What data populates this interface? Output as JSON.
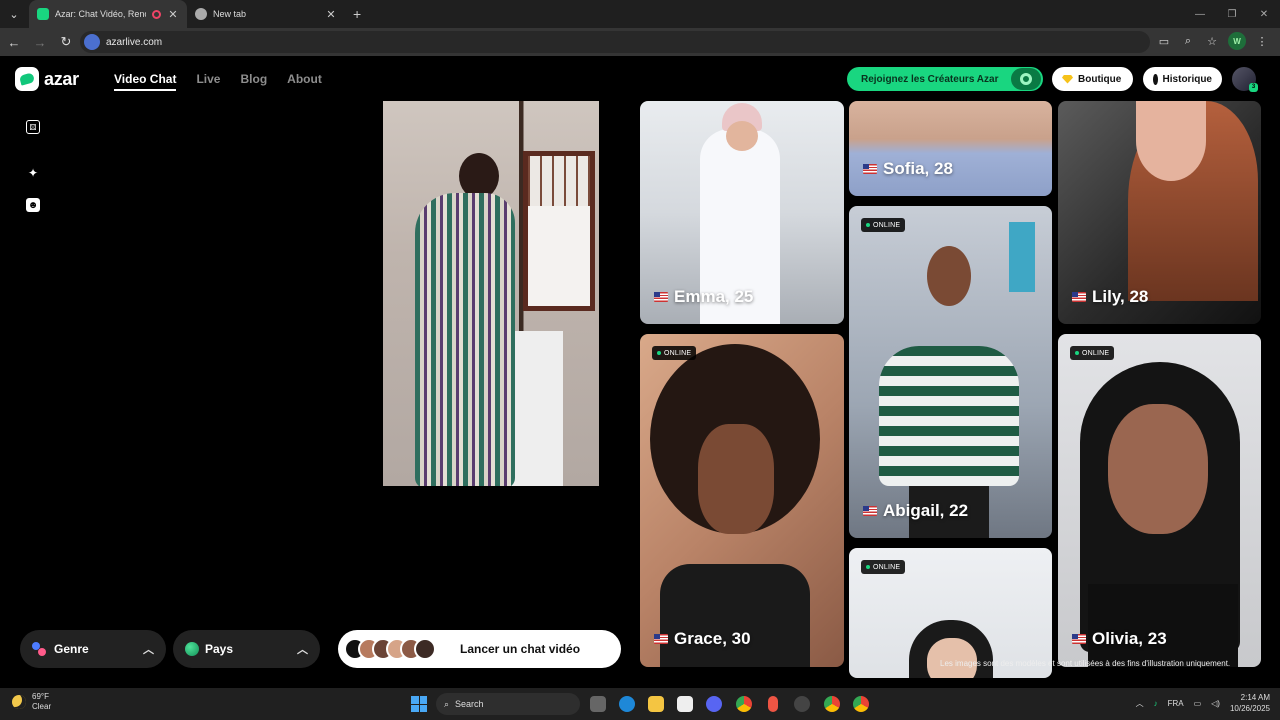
{
  "browser": {
    "tabs": [
      {
        "title": "Azar: Chat Vidéo, Rencontres",
        "active": true
      },
      {
        "title": "New tab",
        "active": false
      }
    ],
    "url": "azarlive.com"
  },
  "site": {
    "logo": "azar",
    "nav": [
      "Video Chat",
      "Live",
      "Blog",
      "About"
    ],
    "creators_label": "Rejoignez les Créateurs Azar",
    "shop_label": "Boutique",
    "history_label": "Historique",
    "avatar_badge": "3"
  },
  "controls": {
    "genre_label": "Genre",
    "country_label": "Pays",
    "start_label": "Lancer un chat vidéo"
  },
  "profiles": [
    {
      "name": "Emma, 25",
      "online": false
    },
    {
      "name": "Sofia, 28",
      "online": false
    },
    {
      "name": "Lily, 28",
      "online": false
    },
    {
      "name": "Abigail, 22",
      "online": true
    },
    {
      "name": "Grace, 30",
      "online": true
    },
    {
      "name": "Olivia, 23",
      "online": true
    },
    {
      "name": "",
      "online": true
    }
  ],
  "online_label": "ONLINE",
  "disclaimer": "Les images sont des modèles et sont utilisées à des fins d'illustration uniquement.",
  "taskbar": {
    "temp": "69°F",
    "condition": "Clear",
    "search_placeholder": "Search",
    "lang": "FRA",
    "time": "2:14 AM",
    "date": "10/26/2025"
  },
  "colors": {
    "accent": "#19d680",
    "background": "#000000"
  }
}
